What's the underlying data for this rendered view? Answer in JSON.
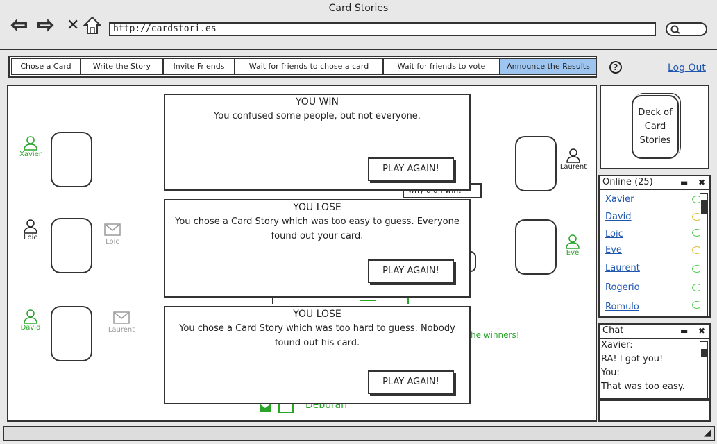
{
  "browser": {
    "title": "Card Stories",
    "url": "http://cardstori.es"
  },
  "tabs": [
    {
      "label": "Chose a Card",
      "active": false
    },
    {
      "label": "Write the Story",
      "active": false
    },
    {
      "label": "Invite Friends",
      "active": false
    },
    {
      "label": "Wait for friends to chose a card",
      "active": false
    },
    {
      "label": "Wait for friends to vote",
      "active": false
    },
    {
      "label": "Announce the Results",
      "active": true
    }
  ],
  "header": {
    "help_icon": "?",
    "logout_label": "Log Out"
  },
  "players_left": [
    {
      "name": "Xavier",
      "color": "#2aa52a"
    },
    {
      "name": "Loic",
      "color": "#222222",
      "invite": "Loic"
    },
    {
      "name": "David",
      "color": "#2aa52a",
      "invite": "Laurent"
    }
  ],
  "players_right": [
    {
      "name": "Laurent",
      "color": "#222222"
    },
    {
      "name": "Eve",
      "color": "#2aa52a"
    }
  ],
  "background_fragments": {
    "question": "why did I win?",
    "winners": "he winners!",
    "deborah": "Deborah"
  },
  "dialogs": [
    {
      "title": "YOU WIN",
      "message": "You confused some people, but not everyone.",
      "button": "PLAY AGAIN!"
    },
    {
      "title": "YOU LOSE",
      "message": "You chose a Card Story which was too easy to guess. Everyone found out your card.",
      "button": "PLAY AGAIN!"
    },
    {
      "title": "YOU LOSE",
      "message": "You chose a Card Story which was too hard to guess. Nobody found out his card.",
      "button": "PLAY AGAIN!"
    }
  ],
  "deck": {
    "label_line1": "Deck of",
    "label_line2": "Card",
    "label_line3": "Stories"
  },
  "online": {
    "title": "Online (25)",
    "users": [
      {
        "name": "Xavier",
        "bubble": "green"
      },
      {
        "name": "David",
        "bubble": "yellow"
      },
      {
        "name": "Loic",
        "bubble": "green"
      },
      {
        "name": "Eve",
        "bubble": "yellow"
      },
      {
        "name": "Laurent",
        "bubble": "green"
      },
      {
        "name": "Rogerio",
        "bubble": "green"
      },
      {
        "name": "Romulo",
        "bubble": "green"
      }
    ]
  },
  "chat": {
    "title": "Chat",
    "lines": [
      "Xavier:",
      "RA! I got you!",
      "You:",
      "That was too easy."
    ]
  },
  "colors": {
    "active_tab": "#9ec5f0",
    "link": "#1f57b0",
    "online_green": "#2aa52a"
  }
}
